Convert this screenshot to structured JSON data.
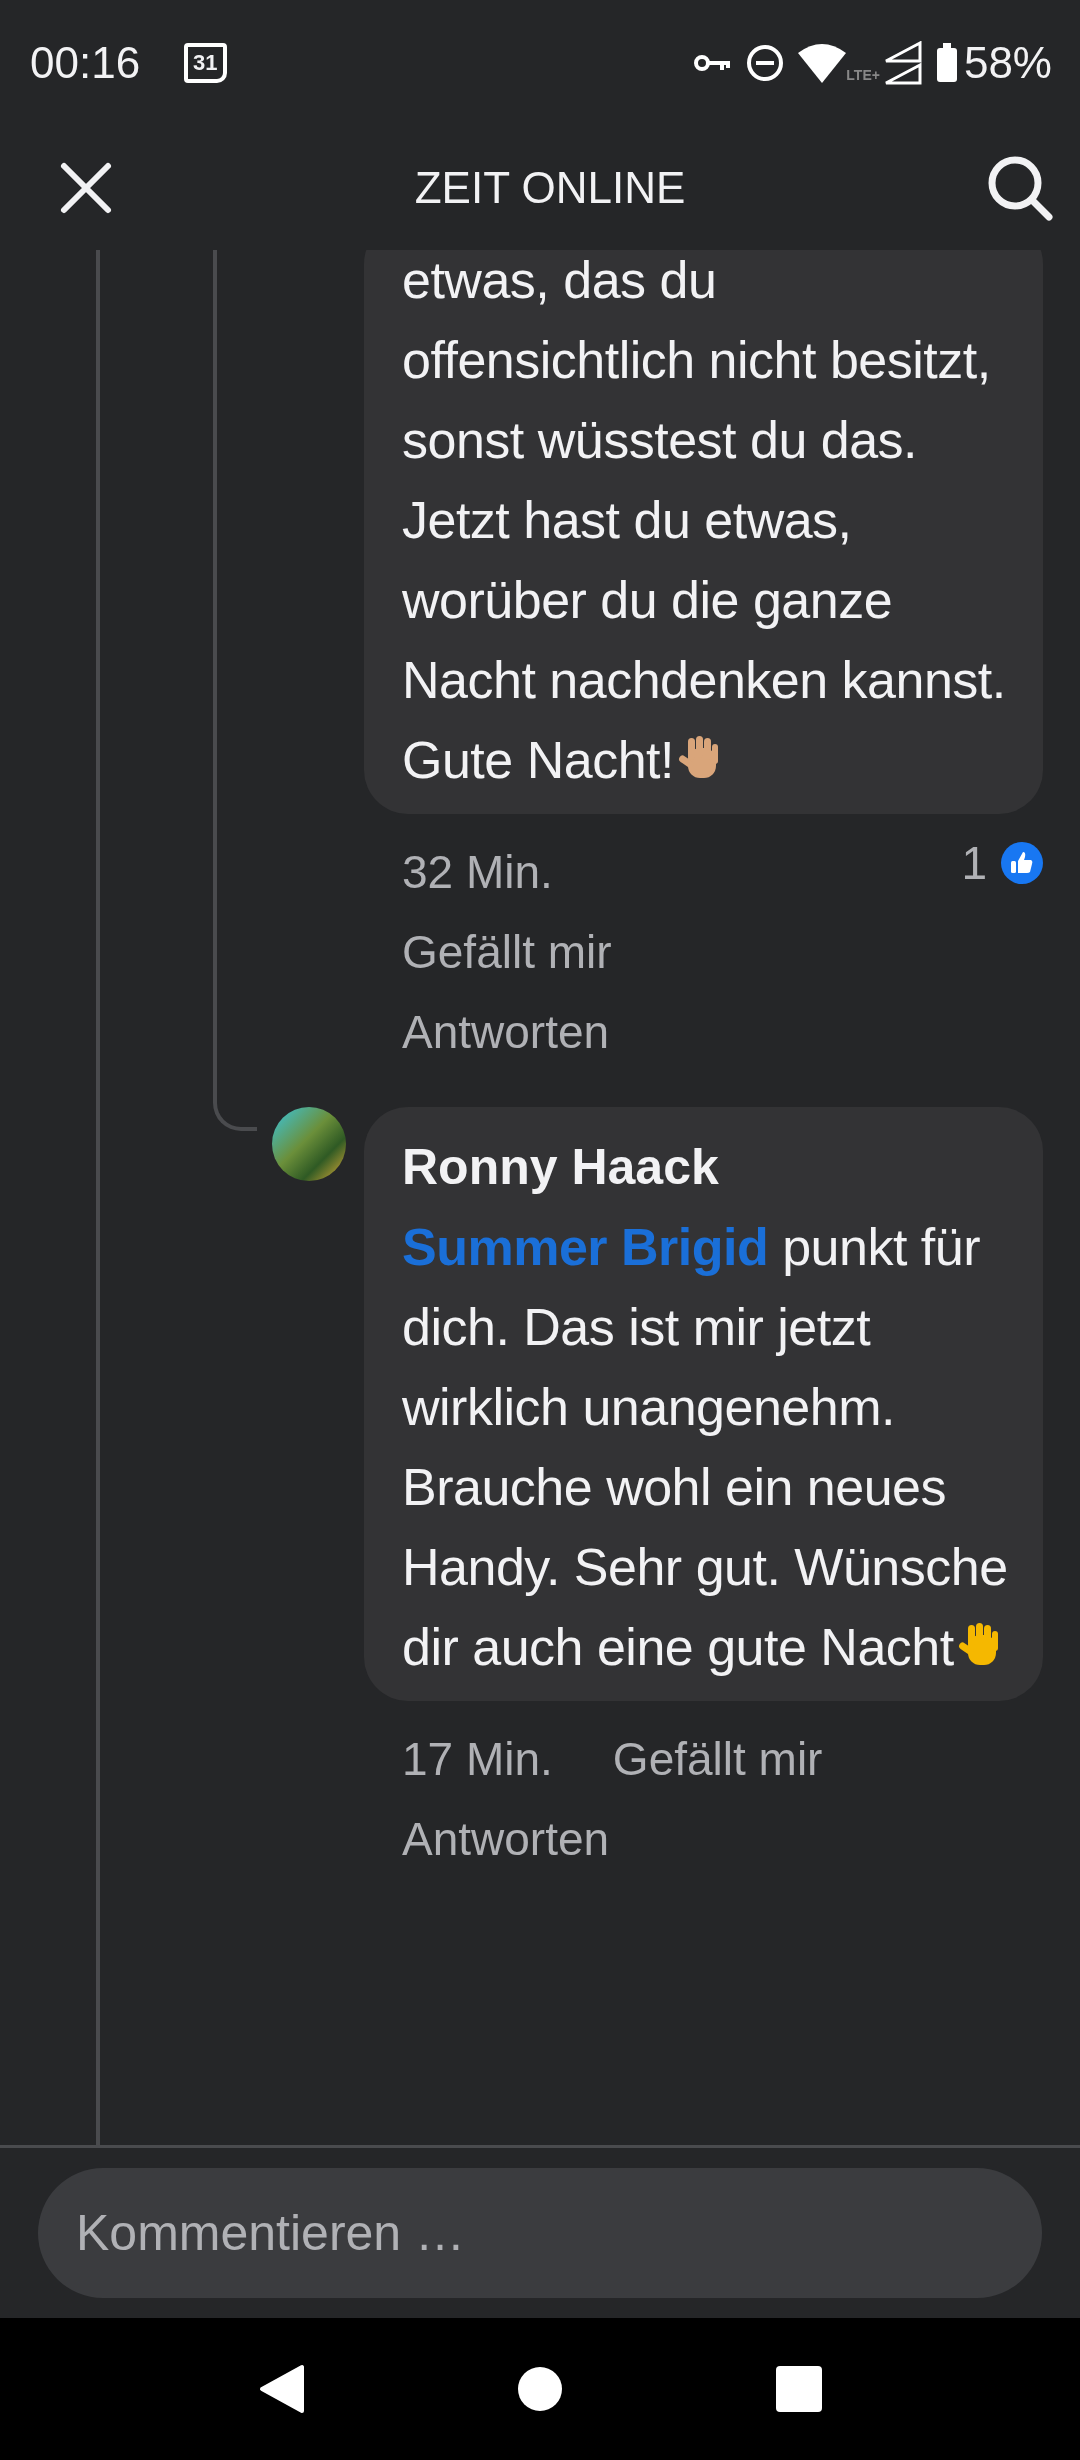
{
  "status_bar": {
    "time": "00:16",
    "calendar_day": "31",
    "network": "LTE+",
    "battery": "58%"
  },
  "header": {
    "title": "ZEIT ONLINE"
  },
  "comments": [
    {
      "text": "etwas, das du offensichtlich nicht besitzt, sonst wüsstest du das. Jetzt hast du etwas, worüber du die ganze Nacht nachdenken kannst. Gute Nacht!",
      "hand_icon": {
        "color": "#d9a57a"
      },
      "time": "32 Min.",
      "like_label": "Gefällt mir",
      "reply_label": "Antworten",
      "likes": "1"
    },
    {
      "author": "Ronny Haack",
      "mention": "Summer Brigid",
      "text": "punkt für dich. Das ist mir jetzt wirklich unangenehm. Brauche wohl ein neues Handy. Sehr gut. Wünsche dir auch eine gute Nacht",
      "hand_icon": {
        "color": "#f5b800"
      },
      "time": "17 Min.",
      "like_label": "Gefällt mir",
      "reply_label": "Antworten"
    }
  ],
  "composer": {
    "placeholder": "Kommentieren …"
  }
}
